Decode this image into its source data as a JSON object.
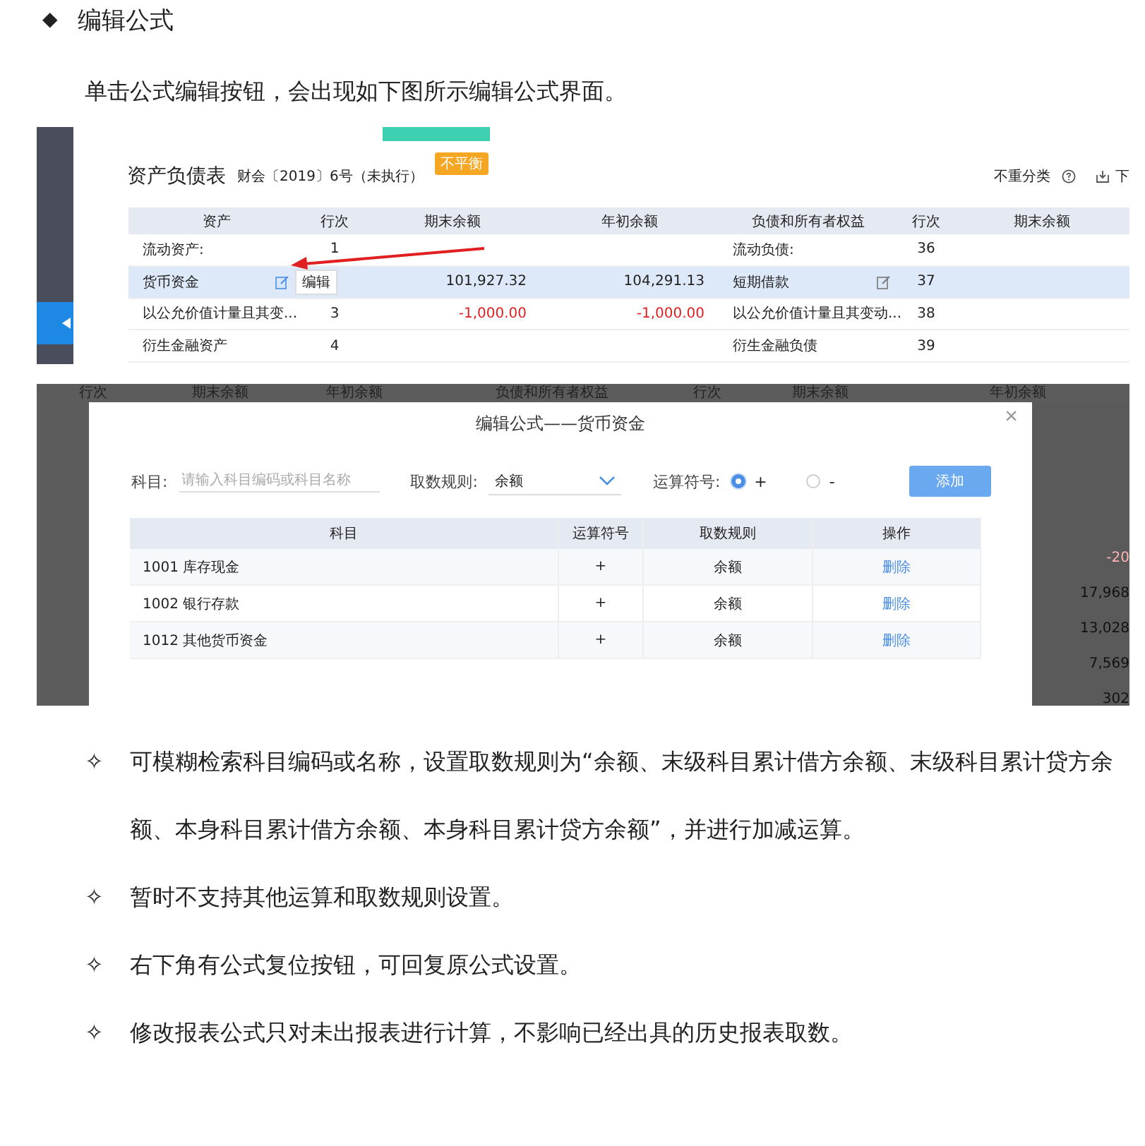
{
  "heading": {
    "bullet": "◆",
    "text": "编辑公式"
  },
  "intro": "单击公式编辑按钮，会出现如下图所示编辑公式界面。",
  "report": {
    "title": "资产负债表",
    "subtitle": "财会〔2019〕6号（未执行）",
    "badge": "不平衡",
    "reclass": "不重分类",
    "download": "下",
    "columns": [
      "资产",
      "行次",
      "期末余额",
      "年初余额",
      "负债和所有者权益",
      "行次",
      "期末余额"
    ],
    "rows": [
      {
        "asset": "流动资产:",
        "asset_line": "1",
        "closing": "",
        "opening": "",
        "liability": "流动负债:",
        "liability_line": "36",
        "highlighted": false,
        "edit_icons": false,
        "negative": false
      },
      {
        "asset": "货币资金",
        "asset_line": "",
        "closing": "101,927.32",
        "opening": "104,291.13",
        "liability": "短期借款",
        "liability_line": "37",
        "highlighted": true,
        "edit_icons": true,
        "negative": false,
        "tooltip": "编辑"
      },
      {
        "asset": "以公允价值计量且其变...",
        "asset_line": "3",
        "closing": "-1,000.00",
        "opening": "-1,000.00",
        "liability": "以公允价值计量且其变动...",
        "liability_line": "38",
        "highlighted": false,
        "edit_icons": false,
        "negative": true
      },
      {
        "asset": "衍生金融资产",
        "asset_line": "4",
        "closing": "",
        "opening": "",
        "liability": "衍生金融负债",
        "liability_line": "39",
        "highlighted": false,
        "edit_icons": false,
        "negative": false
      }
    ]
  },
  "dialog_screen": {
    "behind_columns": [
      "行次",
      "期末余额",
      "年初余额",
      "负债和所有者权益",
      "行次",
      "期末余额",
      "年初余额"
    ],
    "behind_values": [
      {
        "text": "-20",
        "negative": true
      },
      {
        "text": "17,968",
        "negative": false
      },
      {
        "text": "13,028",
        "negative": false
      },
      {
        "text": "7,569",
        "negative": false
      },
      {
        "text": "302",
        "negative": false
      }
    ],
    "title": "编辑公式——货币资金",
    "close": "×",
    "subject_label": "科目:",
    "subject_placeholder": "请输入科目编码或科目名称",
    "rule_label": "取数规则:",
    "rule_value": "余额",
    "operator_label": "运算符号:",
    "operators": [
      {
        "label": "+",
        "selected": true
      },
      {
        "label": "-",
        "selected": false
      }
    ],
    "add_button": "添加",
    "columns": [
      "科目",
      "运算符号",
      "取数规则",
      "操作"
    ],
    "rows": [
      {
        "subject": "1001 库存现金",
        "operator": "+",
        "rule": "余额",
        "action": "删除"
      },
      {
        "subject": "1002 银行存款",
        "operator": "+",
        "rule": "余额",
        "action": "删除"
      },
      {
        "subject": "1012 其他货币资金",
        "operator": "+",
        "rule": "余额",
        "action": "删除"
      }
    ]
  },
  "bullets": [
    {
      "mark": "✧",
      "text": "可模糊检索科目编码或名称，设置取数规则为“余额、末级科目累计借方余额、末级科目累计贷方余额、本身科目累计借方余额、本身科目累计贷方余额”，并进行加减运算。"
    },
    {
      "mark": "✧",
      "text": "暂时不支持其他运算和取数规则设置。"
    },
    {
      "mark": "✧",
      "text": "右下角有公式复位按钮，可回复原公式设置。"
    },
    {
      "mark": "✧",
      "text": "修改报表公式只对未出报表进行计算，不影响已经出具的历史报表取数。"
    }
  ]
}
